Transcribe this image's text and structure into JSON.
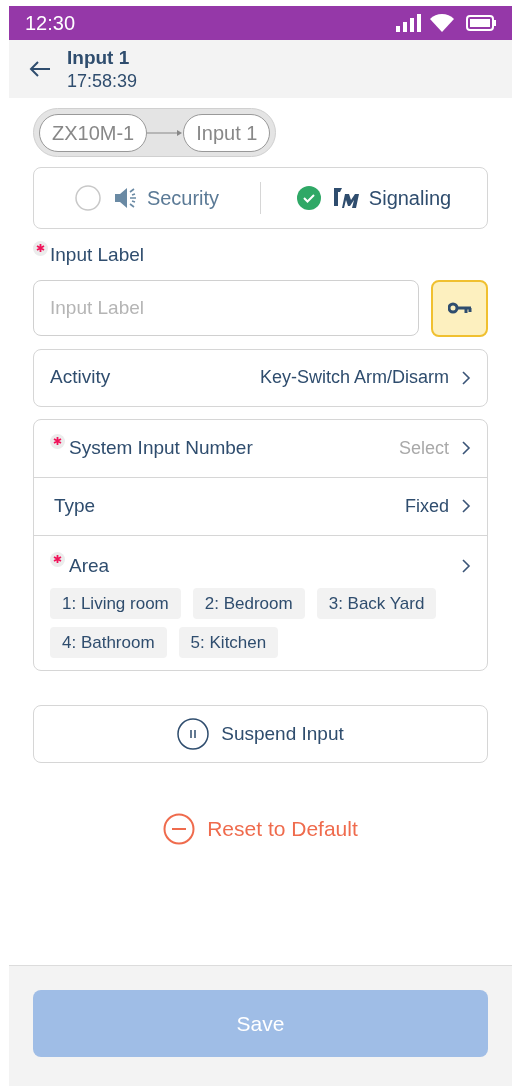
{
  "status_bar": {
    "time": "12:30"
  },
  "header": {
    "title": "Input 1",
    "subtitle": "17:58:39"
  },
  "breadcrumb": [
    "ZX10M-1",
    "Input 1"
  ],
  "modes": [
    {
      "label": "Security",
      "kind": "speaker",
      "selected": false
    },
    {
      "label": "Signaling",
      "kind": "logo",
      "selected": true
    }
  ],
  "input_label": {
    "label": "Input Label",
    "required": true,
    "placeholder": "Input Label"
  },
  "activity": {
    "label": "Activity",
    "value": "Key-Switch Arm/Disarm"
  },
  "settings": [
    {
      "label": "System Input Number",
      "required": true,
      "value": "Select",
      "kind": "placeholder"
    },
    {
      "label": "Type",
      "required": false,
      "value": "Fixed",
      "kind": "value"
    },
    {
      "label": "Area",
      "required": true,
      "kind": "tags",
      "tags": [
        "1: Living room",
        "2: Bedroom",
        "3: Back Yard",
        "4: Bathroom",
        "5: Kitchen"
      ]
    }
  ],
  "suspend_button": "Suspend Input",
  "reset_button": "Reset to Default",
  "save_button": {
    "label": "Save",
    "disabled": true
  }
}
